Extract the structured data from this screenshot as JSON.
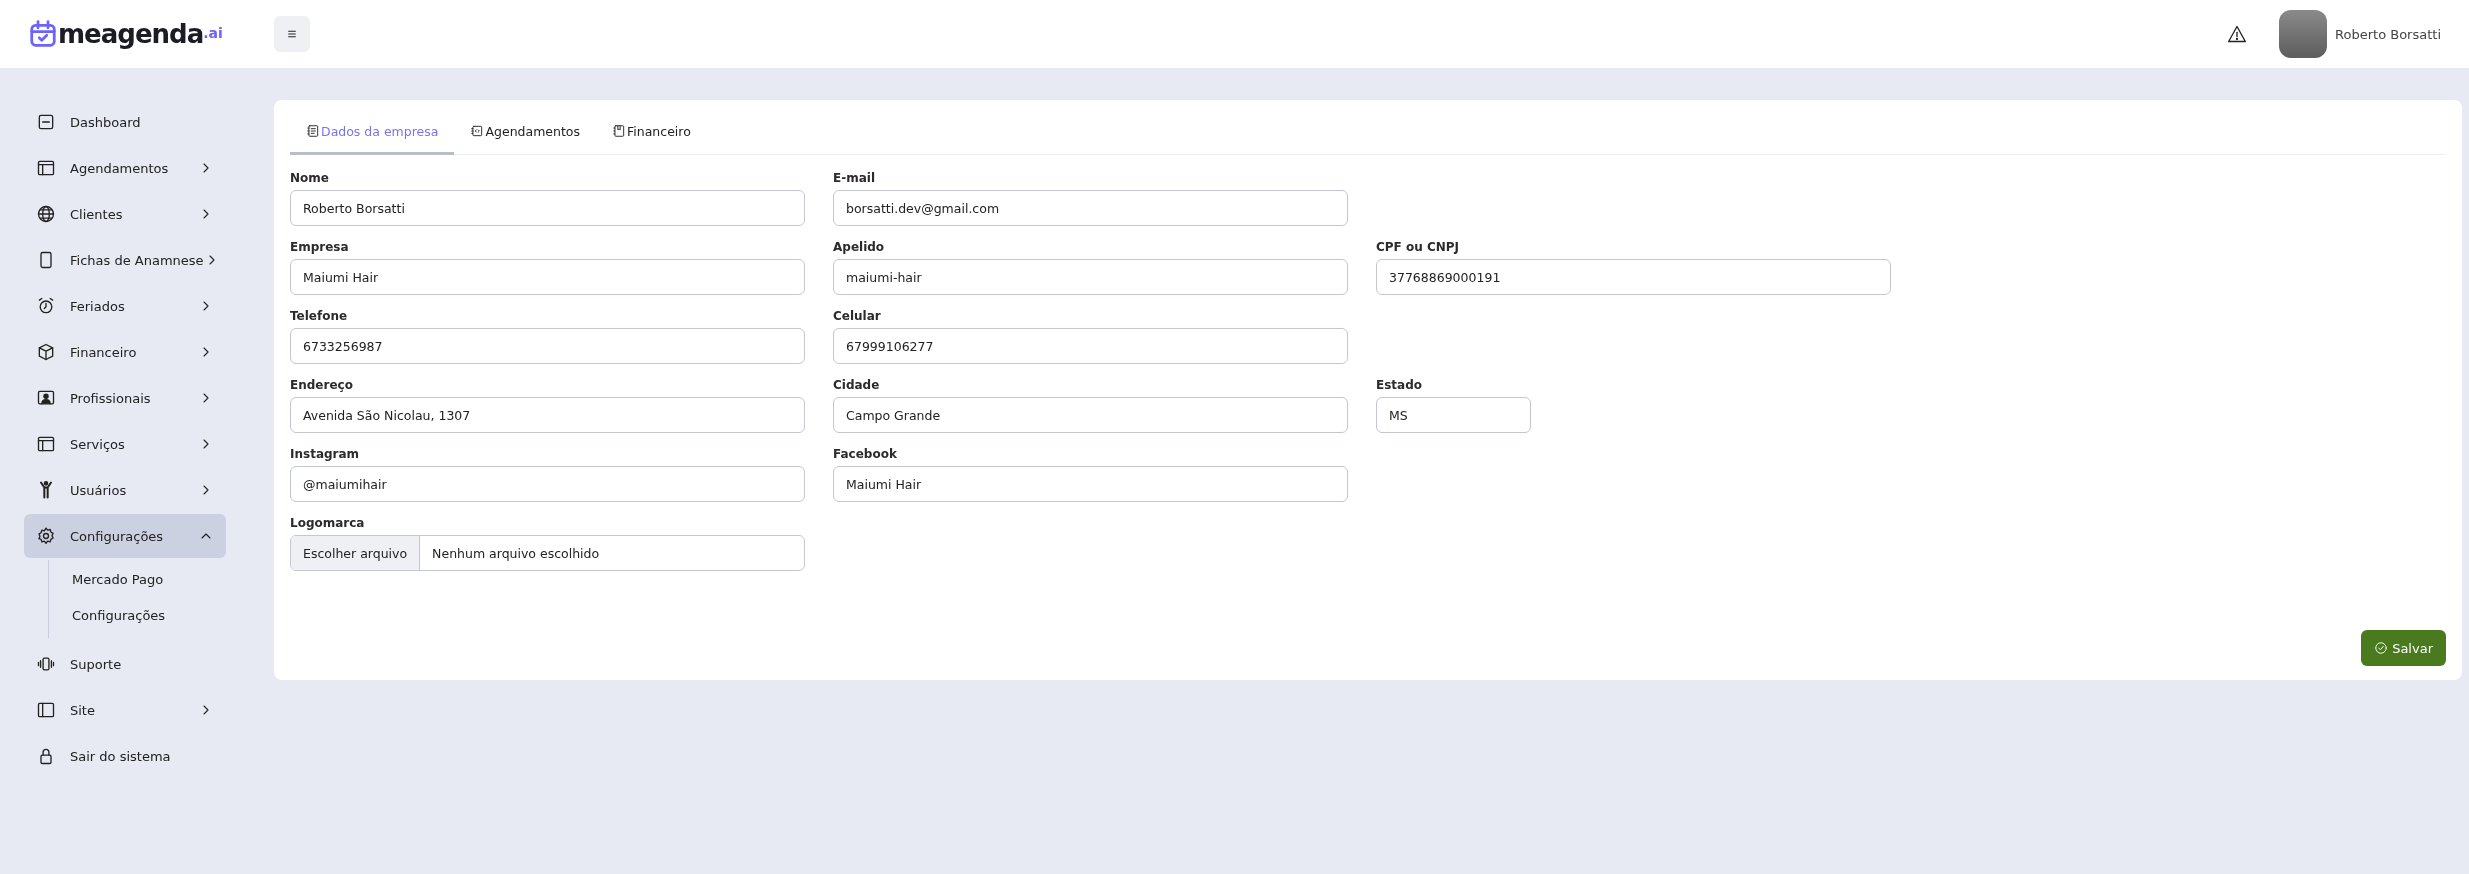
{
  "header": {
    "logo": {
      "name": "meagenda",
      "suffix": ".ai"
    },
    "user": {
      "name": "Roberto Borsatti"
    }
  },
  "sidebar": {
    "items": [
      {
        "label": "Dashboard"
      },
      {
        "label": "Agendamentos",
        "expanded": false
      },
      {
        "label": "Clientes",
        "expanded": false
      },
      {
        "label": "Fichas de Anamnese",
        "expanded": false
      },
      {
        "label": "Feriados",
        "expanded": false
      },
      {
        "label": "Financeiro",
        "expanded": false
      },
      {
        "label": "Profissionais",
        "expanded": false
      },
      {
        "label": "Serviços",
        "expanded": false
      },
      {
        "label": "Usuários",
        "expanded": false
      },
      {
        "label": "Configurações",
        "expanded": true,
        "children": [
          {
            "label": "Mercado Pago"
          },
          {
            "label": "Configurações"
          }
        ]
      },
      {
        "label": "Suporte"
      },
      {
        "label": "Site",
        "expanded": false
      },
      {
        "label": "Sair do sistema"
      }
    ]
  },
  "tabs": [
    {
      "label": "Dados da empresa",
      "selected": true
    },
    {
      "label": "Agendamentos",
      "selected": false
    },
    {
      "label": "Financeiro",
      "selected": false
    }
  ],
  "form": {
    "rows": [
      [
        {
          "kind": "text",
          "label": "Nome",
          "value": "Roberto Borsatti"
        },
        {
          "kind": "text",
          "label": "E-mail",
          "value": "borsatti.dev@gmail.com"
        }
      ],
      [
        {
          "kind": "text",
          "label": "Empresa",
          "value": "Maiumi Hair"
        },
        {
          "kind": "text",
          "label": "Apelido",
          "value": "maiumi-hair"
        },
        {
          "kind": "text",
          "label": "CPF ou CNPJ",
          "value": "37768869000191"
        }
      ],
      [
        {
          "kind": "text",
          "label": "Telefone",
          "value": "6733256987"
        },
        {
          "kind": "text",
          "label": "Celular",
          "value": "67999106277"
        }
      ],
      [
        {
          "kind": "text",
          "label": "Endereço",
          "value": "Avenida São Nicolau, 1307"
        },
        {
          "kind": "text",
          "label": "Cidade",
          "value": "Campo Grande"
        },
        {
          "kind": "short",
          "label": "Estado",
          "value": "MS"
        }
      ],
      [
        {
          "kind": "text",
          "label": "Instagram",
          "value": "@maiumihair"
        },
        {
          "kind": "text",
          "label": "Facebook",
          "value": "Maiumi Hair"
        }
      ],
      [
        {
          "kind": "file",
          "label": "Logomarca",
          "button": "Escolher arquivo",
          "value": "Nenhum arquivo escolhido"
        }
      ]
    ],
    "save_button": "Salvar"
  }
}
